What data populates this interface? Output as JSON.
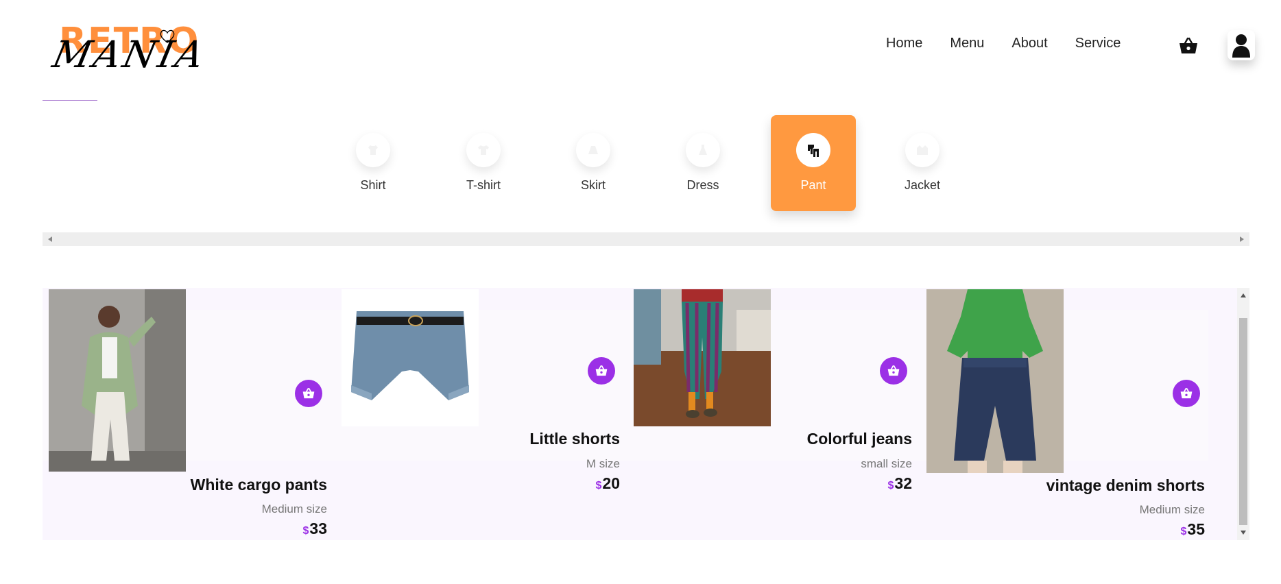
{
  "brand": {
    "logo_top": "RETRO",
    "logo_bottom": "MANIA",
    "accent_color": "#ff8f3c",
    "purple_color": "#9b30e6"
  },
  "nav": {
    "items": [
      "Home",
      "Menu",
      "About",
      "Service"
    ],
    "cart_icon": "basket-icon",
    "user_icon": "user-icon"
  },
  "categories": {
    "items": [
      {
        "label": "Shirt",
        "icon": "shirt-icon"
      },
      {
        "label": "T-shirt",
        "icon": "tshirt-icon"
      },
      {
        "label": "Skirt",
        "icon": "skirt-icon"
      },
      {
        "label": "Dress",
        "icon": "dress-icon"
      },
      {
        "label": "Pant",
        "icon": "pants-icon"
      },
      {
        "label": "Jacket",
        "icon": "jacket-icon"
      }
    ],
    "active": "Pant"
  },
  "products": [
    {
      "name": "White cargo pants",
      "size": "Medium size",
      "currency": "$",
      "price": "33"
    },
    {
      "name": "Little shorts",
      "size": "M size",
      "currency": "$",
      "price": "20"
    },
    {
      "name": "Colorful jeans",
      "size": "small size",
      "currency": "$",
      "price": "32"
    },
    {
      "name": "vintage denim shorts",
      "size": "Medium size",
      "currency": "$",
      "price": "35"
    }
  ]
}
